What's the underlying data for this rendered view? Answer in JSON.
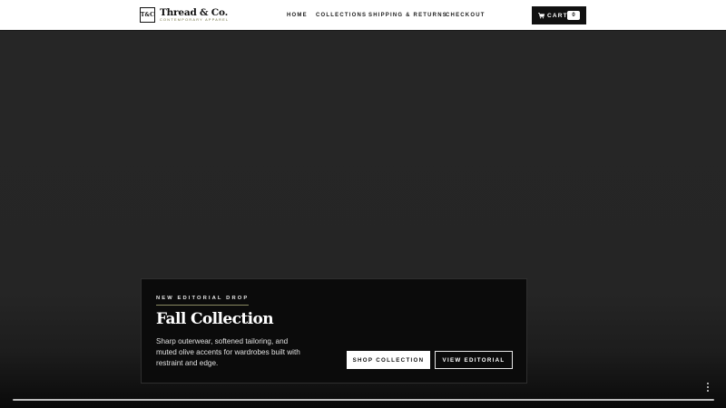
{
  "brand": {
    "mark": "T&C",
    "name": "Thread & Co.",
    "tagline": "CONTEMPORARY APPAREL"
  },
  "nav": {
    "items": [
      {
        "label": "HOME"
      },
      {
        "label": "COLLECTIONS"
      },
      {
        "label": "SHIPPING & RETURNS"
      },
      {
        "label": "CHECKOUT"
      }
    ]
  },
  "cart": {
    "label": "CART",
    "count": "0",
    "icon": "cart-icon"
  },
  "hero": {
    "eyebrow": "NEW EDITORIAL DROP",
    "title": "Fall Collection",
    "description": "Sharp outerwear, softened tailoring, and muted olive accents for wardrobes built with restraint and edge.",
    "primary_cta": "SHOP COLLECTION",
    "secondary_cta": "VIEW EDITORIAL"
  },
  "colors": {
    "accent": "#8a8a62",
    "background": "#252525",
    "panel": "#0b0b0b"
  }
}
